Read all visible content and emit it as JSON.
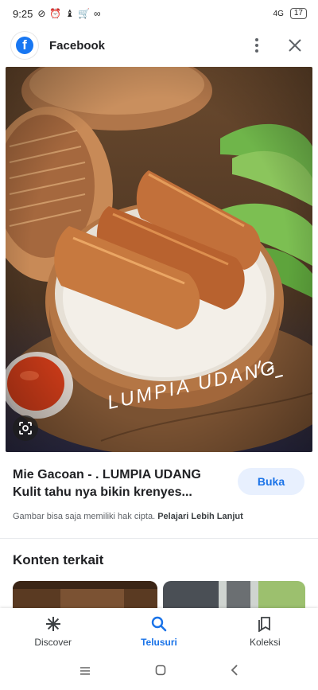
{
  "status_bar": {
    "time": "9:25",
    "network": "4G",
    "battery": "17",
    "icons": [
      "data-saver-icon",
      "alarm-icon",
      "wellbeing-icon",
      "shopping-cart-icon",
      "mirror-link-icon"
    ]
  },
  "app_bar": {
    "source_name": "Facebook",
    "logo_letter": "f",
    "more_icon": "more-vert-icon",
    "close_icon": "close-icon"
  },
  "image": {
    "overlay_text": "LUMPIA UDANG",
    "lens_icon": "lens-icon"
  },
  "result": {
    "title": "Mie Gacoan - . LUMPIA UDANG Kulit tahu nya bikin krenyes...",
    "open_label": "Buka",
    "copyright_notice": "Gambar bisa saja memiliki hak cipta.",
    "learn_more": "Pelajari Lebih Lanjut"
  },
  "related": {
    "heading": "Konten terkait"
  },
  "bottom_nav": {
    "items": [
      {
        "label": "Discover",
        "icon": "asterisk-icon",
        "active": false
      },
      {
        "label": "Telusuri",
        "icon": "search-icon",
        "active": true
      },
      {
        "label": "Koleksi",
        "icon": "collections-icon",
        "active": false
      }
    ]
  },
  "system_nav": [
    "recents-icon",
    "home-icon",
    "back-icon"
  ],
  "colors": {
    "accent": "#1a73e8",
    "open_button_bg": "#e8f0fe",
    "facebook_blue": "#1877f2"
  }
}
